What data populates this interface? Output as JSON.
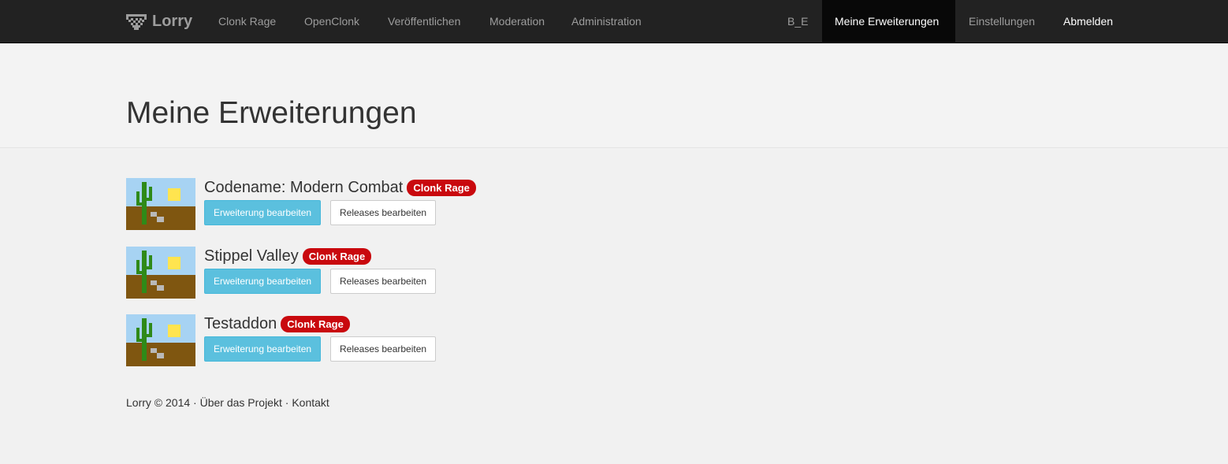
{
  "nav": {
    "brand": "Lorry",
    "items": [
      "Clonk Rage",
      "OpenClonk",
      "Veröffentlichen",
      "Moderation",
      "Administration"
    ],
    "user": "B_E",
    "my_addons": "Meine Erweiterungen",
    "settings": "Einstellungen",
    "logout": "Abmelden"
  },
  "page": {
    "title": "Meine Erweiterungen"
  },
  "addons": [
    {
      "name": "Codename: Modern Combat",
      "game": "Clonk Rage",
      "edit_label": "Erweiterung bearbeiten",
      "releases_label": "Releases bearbeiten"
    },
    {
      "name": "Stippel Valley",
      "game": "Clonk Rage",
      "edit_label": "Erweiterung bearbeiten",
      "releases_label": "Releases bearbeiten"
    },
    {
      "name": "Testaddon",
      "game": "Clonk Rage",
      "edit_label": "Erweiterung bearbeiten",
      "releases_label": "Releases bearbeiten"
    }
  ],
  "footer": {
    "copyright": "Lorry © 2014",
    "separator": "·",
    "about": "Über das Projekt",
    "contact": "Kontakt"
  },
  "colors": {
    "badge": "#c9090e",
    "primary_button": "#5bc0de",
    "navbar": "#222222"
  }
}
